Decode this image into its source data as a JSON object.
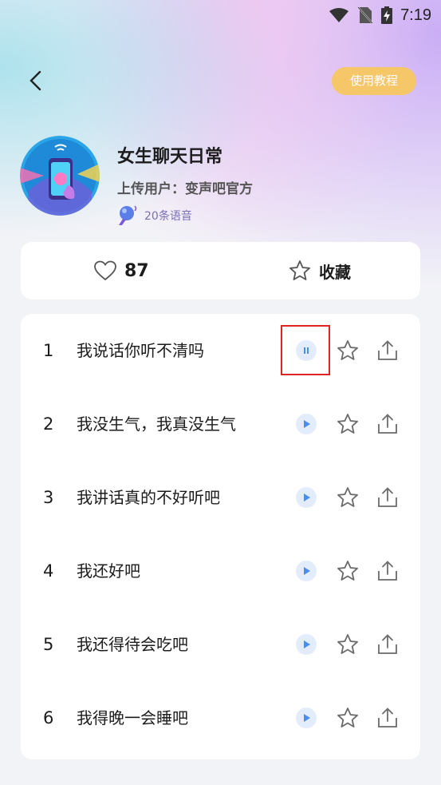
{
  "status_bar": {
    "time": "7:19"
  },
  "header": {
    "tutorial_label": "使用教程"
  },
  "album": {
    "title": "女生聊天日常",
    "uploader": "上传用户：变声吧官方",
    "count": "20条语音"
  },
  "actions": {
    "likes": "87",
    "favorite_label": "收藏"
  },
  "tracks": [
    {
      "index": "1",
      "name": "我说话你听不清吗",
      "state": "playing"
    },
    {
      "index": "2",
      "name": "我没生气，我真没生气",
      "state": "paused"
    },
    {
      "index": "3",
      "name": "我讲话真的不好听吧",
      "state": "paused"
    },
    {
      "index": "4",
      "name": "我还好吧",
      "state": "paused"
    },
    {
      "index": "5",
      "name": "我还得待会吃吧",
      "state": "paused"
    },
    {
      "index": "6",
      "name": "我得晚一会睡吧",
      "state": "paused"
    }
  ],
  "colors": {
    "accent": "#4a8df0",
    "tutorial_button": "#f6c769",
    "highlight_box": "#e02424"
  }
}
